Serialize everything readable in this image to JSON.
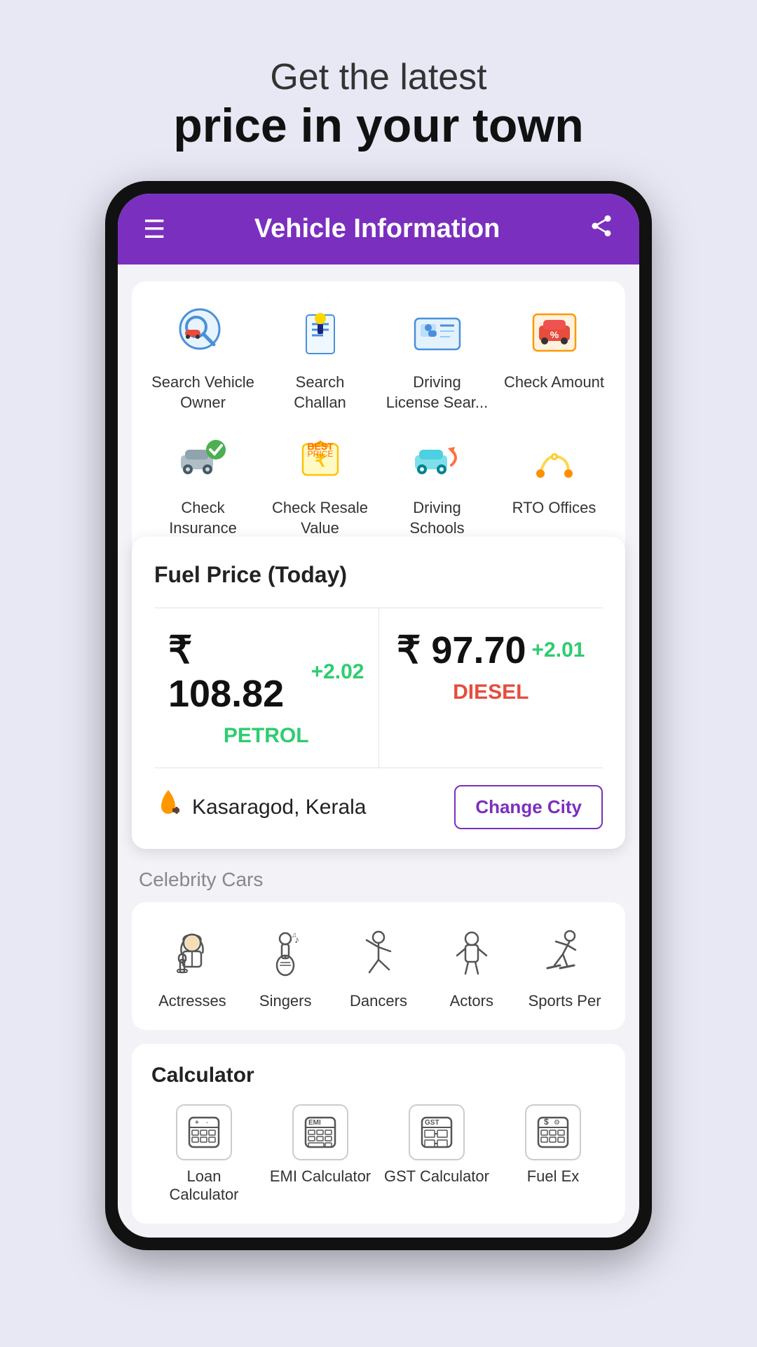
{
  "hero": {
    "sub_text": "Get the latest",
    "main_text": "price in your town"
  },
  "app": {
    "title": "Vehicle Information",
    "header_bg": "#7b2fbe"
  },
  "services": {
    "items": [
      {
        "id": "search-vehicle",
        "label": "Search Vehicle Owner",
        "icon": "🔍🚗"
      },
      {
        "id": "search-challan",
        "label": "Search Challan",
        "icon": "👮"
      },
      {
        "id": "driving-license",
        "label": "Driving License Sear...",
        "icon": "🪪"
      },
      {
        "id": "check-amount",
        "label": "Check Amount",
        "icon": "🏷️"
      },
      {
        "id": "check-insurance",
        "label": "Check Insurance",
        "icon": "🚗✅"
      },
      {
        "id": "check-resale",
        "label": "Check Resale Value",
        "icon": "💰"
      },
      {
        "id": "driving-schools",
        "label": "Driving Schools",
        "icon": "🚗↩️"
      },
      {
        "id": "rto-offices",
        "label": "RTO Offices",
        "icon": "🗺️"
      }
    ]
  },
  "fuel": {
    "title": "Fuel Price (Today)",
    "petrol_price": "₹ 108.82",
    "petrol_change": "+2.02",
    "petrol_label": "PETROL",
    "diesel_price": "₹ 97.70",
    "diesel_change": "+2.01",
    "diesel_label": "DIESEL",
    "city": "Kasaragod, Kerala",
    "change_city_btn": "Change City"
  },
  "celebrity_cars": {
    "section_title": "Celebrity Cars",
    "items": [
      {
        "id": "actresses",
        "label": "Actresses",
        "icon": "👩‍🎤"
      },
      {
        "id": "singers",
        "label": "Singers",
        "icon": "🎸"
      },
      {
        "id": "dancers",
        "label": "Dancers",
        "icon": "💃"
      },
      {
        "id": "actors",
        "label": "Actors",
        "icon": "🎭"
      },
      {
        "id": "sports-per",
        "label": "Sports Per",
        "icon": "⛷️"
      }
    ]
  },
  "calculator": {
    "section_title": "Calculator",
    "items": [
      {
        "id": "loan-calc",
        "label": "Loan Calculator",
        "icon": "🧮"
      },
      {
        "id": "emi-calc",
        "label": "EMI Calculator",
        "icon": "📊"
      },
      {
        "id": "gst-calc",
        "label": "GST Calculator",
        "icon": "🧾"
      },
      {
        "id": "fuel-ex",
        "label": "Fuel Ex",
        "icon": "💵"
      }
    ]
  }
}
